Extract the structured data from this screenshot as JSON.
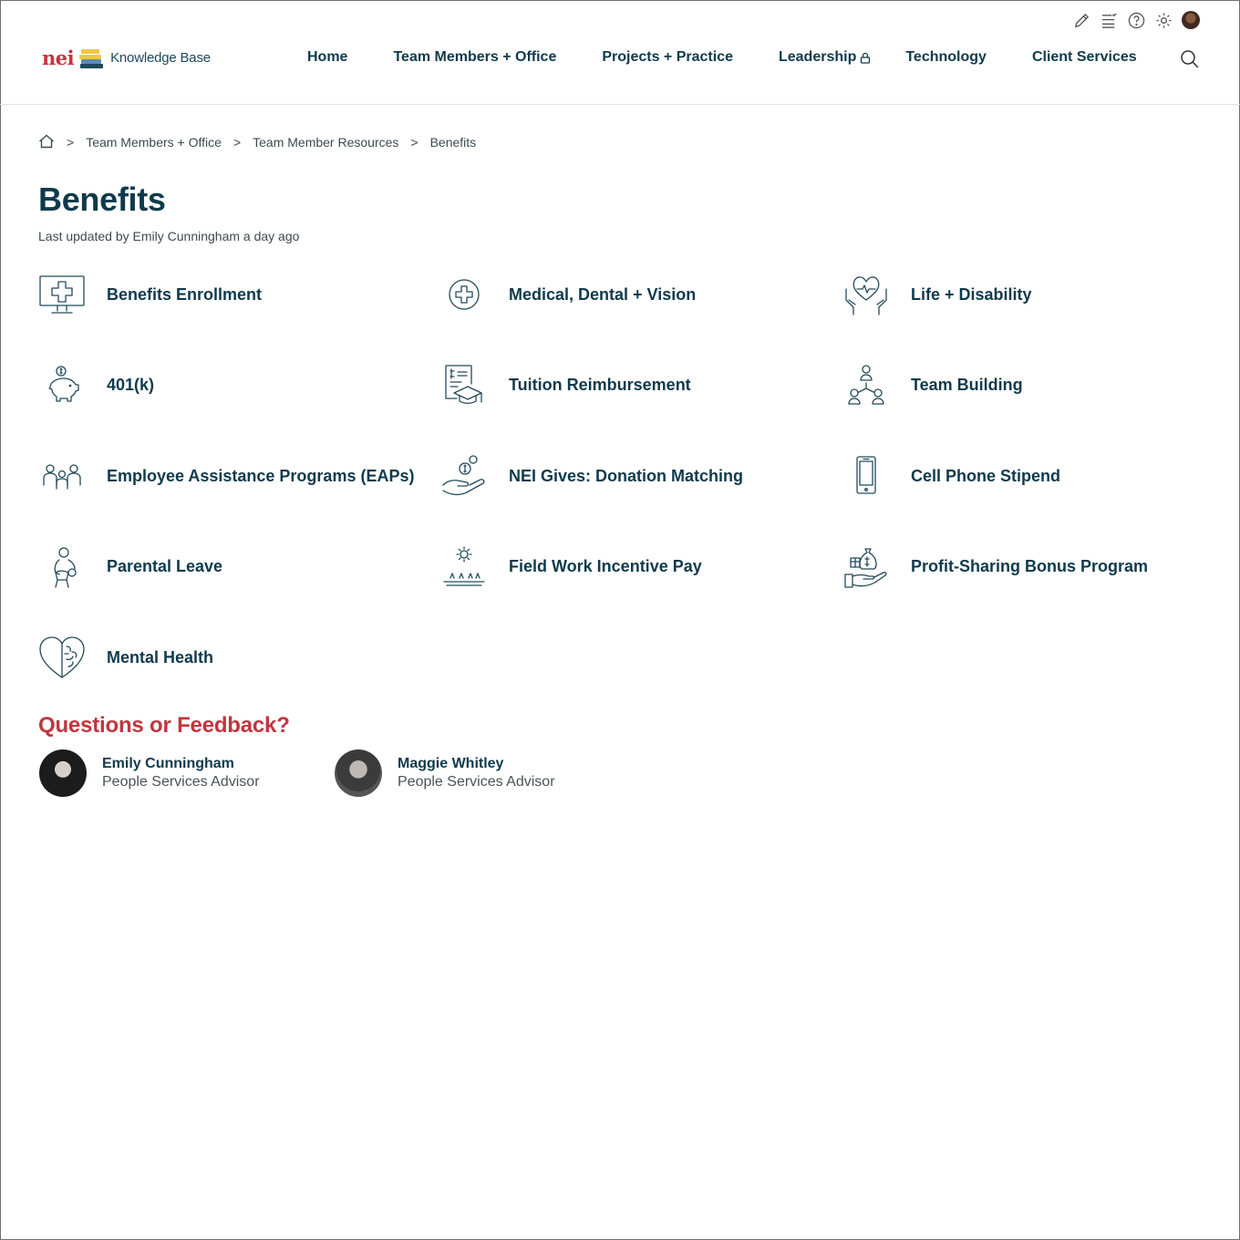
{
  "header": {
    "logo_brand": "nei",
    "logo_text": "Knowledge Base",
    "nav": [
      {
        "label": "Home"
      },
      {
        "label": "Team Members + Office"
      },
      {
        "label": "Projects + Practice"
      },
      {
        "label": "Leadership"
      },
      {
        "label": "Technology"
      },
      {
        "label": "Client Services"
      }
    ],
    "utility_icons": [
      "pencil-icon",
      "list-check-icon",
      "help-circle-icon",
      "gear-icon",
      "user-avatar"
    ]
  },
  "breadcrumb": {
    "items": [
      "Team Members + Office",
      "Team Member Resources",
      "Benefits"
    ],
    "separator": ">"
  },
  "page": {
    "title": "Benefits",
    "updated": "Last updated by Emily Cunningham a day ago"
  },
  "benefits": [
    {
      "label": "Benefits Enrollment",
      "icon": "monitor-medical-cross-icon"
    },
    {
      "label": "Medical, Dental + Vision",
      "icon": "medical-cross-circle-icon"
    },
    {
      "label": "Life + Disability",
      "icon": "hands-heart-icon"
    },
    {
      "label": "401(k)",
      "icon": "piggy-bank-icon"
    },
    {
      "label": "Tuition Reimbursement",
      "icon": "graduation-cap-document-icon"
    },
    {
      "label": "Team Building",
      "icon": "team-network-icon"
    },
    {
      "label": "Employee Assistance Programs (EAPs)",
      "icon": "people-group-icon"
    },
    {
      "label": "NEI Gives: Donation Matching",
      "icon": "hand-coins-icon"
    },
    {
      "label": "Cell Phone Stipend",
      "icon": "mobile-phone-icon"
    },
    {
      "label": "Parental Leave",
      "icon": "parent-child-icon"
    },
    {
      "label": "Field Work Incentive Pay",
      "icon": "sun-field-icon"
    },
    {
      "label": "Profit-Sharing Bonus Program",
      "icon": "hand-money-bag-icon"
    },
    {
      "label": "Mental Health",
      "icon": "heart-brain-icon"
    }
  ],
  "feedback": {
    "heading": "Questions or Feedback?",
    "contacts": [
      {
        "name": "Emily Cunningham",
        "role": "People Services Advisor"
      },
      {
        "name": "Maggie Whitley",
        "role": "People Services Advisor"
      }
    ]
  },
  "colors": {
    "primary_text": "#0f3a4c",
    "brand_red": "#c8313e",
    "feedback_heading": "#c1353f"
  }
}
